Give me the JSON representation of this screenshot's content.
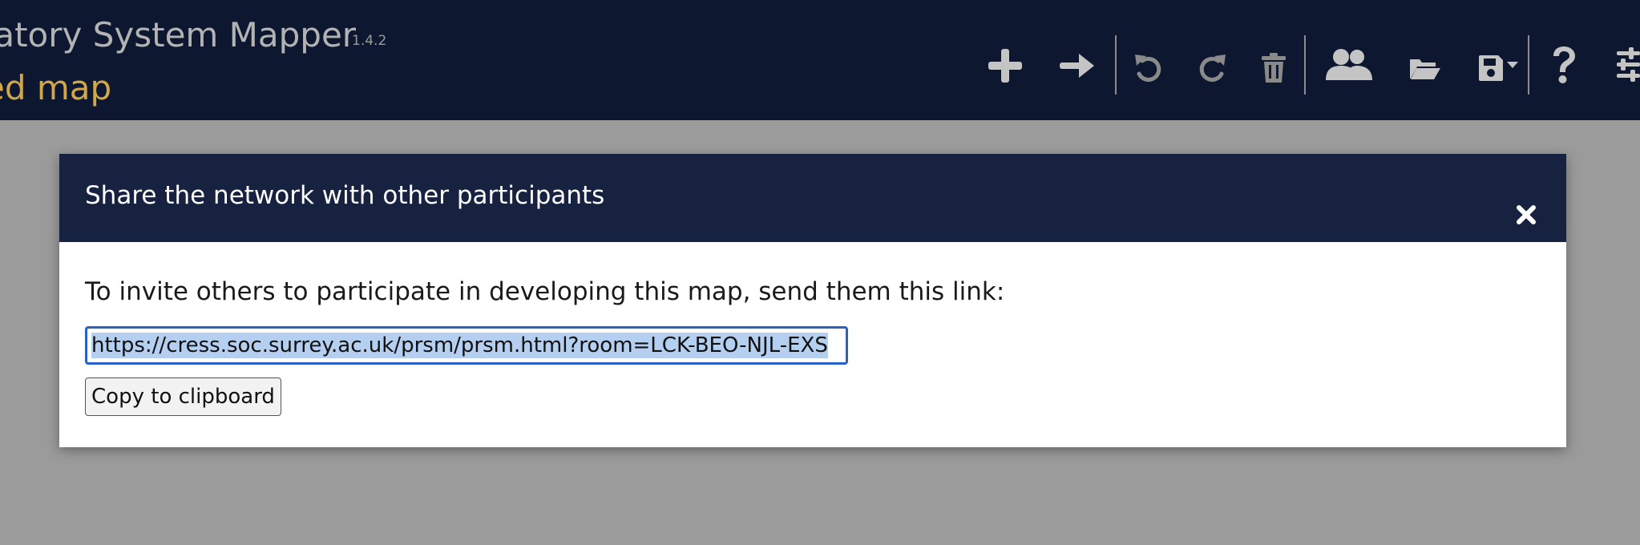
{
  "header": {
    "app_title": "ipatory System Mapper",
    "version": "1.4.2",
    "map_title": "ed map"
  },
  "toolbar": {
    "items": [
      {
        "name": "add-node",
        "icon": "plus-icon"
      },
      {
        "name": "add-link",
        "icon": "arrow-right-icon"
      },
      {
        "name": "undo",
        "icon": "undo-icon"
      },
      {
        "name": "redo",
        "icon": "redo-icon"
      },
      {
        "name": "delete",
        "icon": "trash-icon"
      },
      {
        "name": "share",
        "icon": "users-icon"
      },
      {
        "name": "open",
        "icon": "folder-open-icon"
      },
      {
        "name": "save",
        "icon": "save-dropdown-icon"
      },
      {
        "name": "help",
        "icon": "question-icon"
      },
      {
        "name": "settings",
        "icon": "sliders-icon"
      }
    ]
  },
  "modal": {
    "title": "Share the network with other participants",
    "close_icon": "close-icon",
    "invite_text": "To invite others to participate in developing this map, send them this link:",
    "link_value": "https://cress.soc.surrey.ac.uk/prsm/prsm.html?room=LCK-BEO-NJL-EXS",
    "copy_label": "Copy to clipboard"
  },
  "colors": {
    "navbar_bg": "#0d1830",
    "modal_header_bg": "#16223f",
    "map_title": "#d2a74a",
    "overlay": "#9b9b9b",
    "input_focus_border": "#2762c9",
    "selection": "#b4cff0"
  }
}
